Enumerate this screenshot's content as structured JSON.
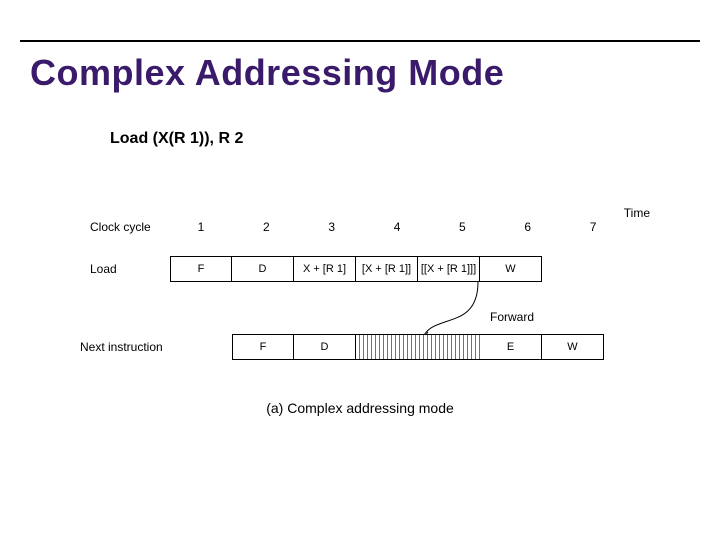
{
  "title": "Complex Addressing Mode",
  "subtitle": "Load  (X(R 1)), R 2",
  "time_label": "Time",
  "clock": {
    "label": "Clock cycle",
    "values": [
      "1",
      "2",
      "3",
      "4",
      "5",
      "6",
      "7"
    ]
  },
  "rows": {
    "load": {
      "label": "Load",
      "cells": [
        "F",
        "D",
        "X + [R 1]",
        "[X + [R 1]]",
        "[[X + [R 1]]]",
        "W"
      ]
    },
    "next": {
      "label": "Next instruction",
      "cells_pre": [
        "F",
        "D"
      ],
      "cells_post": [
        "E",
        "W"
      ]
    }
  },
  "forward_label": "Forward",
  "caption": "(a) Complex addressing mode"
}
